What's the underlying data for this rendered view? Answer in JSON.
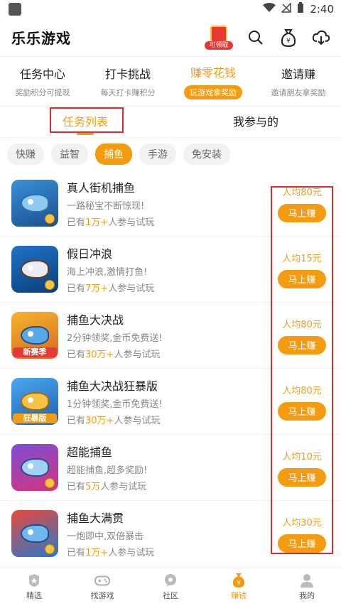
{
  "status_bar": {
    "time": "2:40"
  },
  "header": {
    "title": "乐乐游戏",
    "redpack_label": "可领取"
  },
  "category_tabs": [
    {
      "title": "任务中心",
      "sub": "奖励积分可提现"
    },
    {
      "title": "打卡挑战",
      "sub": "每天打卡赚积分"
    },
    {
      "title": "赚零花钱",
      "sub": "玩游戏拿奖励"
    },
    {
      "title": "邀请赚",
      "sub": "邀请朋友拿奖励"
    }
  ],
  "sub_tabs": [
    {
      "label": "任务列表"
    },
    {
      "label": "我参与的"
    }
  ],
  "chips": [
    "快赚",
    "益智",
    "捕鱼",
    "手游",
    "免安装"
  ],
  "games": [
    {
      "name": "真人街机捕鱼",
      "desc": "一路秘宝不断惊现!",
      "stats_prefix": "已有",
      "count": "1万+",
      "stats_suffix": "人参与试玩",
      "reward": "人均80元",
      "button": "马上赚"
    },
    {
      "name": "假日冲浪",
      "desc": "海上冲浪,激情打鱼!",
      "stats_prefix": "已有",
      "count": "7万+",
      "stats_suffix": "人参与试玩",
      "reward": "人均15元",
      "button": "马上赚"
    },
    {
      "name": "捕鱼大决战",
      "desc": "2分钟领奖,金币免费送!",
      "stats_prefix": "已有",
      "count": "30万+",
      "stats_suffix": "人参与试玩",
      "reward": "人均80元",
      "button": "马上赚",
      "badge": "新赛季"
    },
    {
      "name": "捕鱼大决战狂暴版",
      "desc": "1分钟领奖,金币免费送!",
      "stats_prefix": "已有",
      "count": "30万+",
      "stats_suffix": "人参与试玩",
      "reward": "人均80元",
      "button": "马上赚",
      "badge": "狂暴版"
    },
    {
      "name": "超能捕鱼",
      "desc": "超能捕鱼,超多奖励!",
      "stats_prefix": "已有",
      "count": "5万",
      "stats_suffix": "人参与试玩",
      "reward": "人均10元",
      "button": "马上赚"
    },
    {
      "name": "捕鱼大满贯",
      "desc": "一炮即中,双倍暴击",
      "stats_prefix": "已有",
      "count": "1万+",
      "stats_suffix": "人参与试玩",
      "reward": "人均30元",
      "button": "马上赚"
    }
  ],
  "bottom_nav": [
    {
      "label": "精选",
      "icon": "star-icon"
    },
    {
      "label": "找游戏",
      "icon": "gamepad-icon"
    },
    {
      "label": "社区",
      "icon": "chat-icon"
    },
    {
      "label": "赚钱",
      "icon": "money-bag-icon"
    },
    {
      "label": "我的",
      "icon": "user-icon"
    }
  ],
  "colors": {
    "accent": "#f39c12",
    "highlight_box": "#d32f2f"
  }
}
